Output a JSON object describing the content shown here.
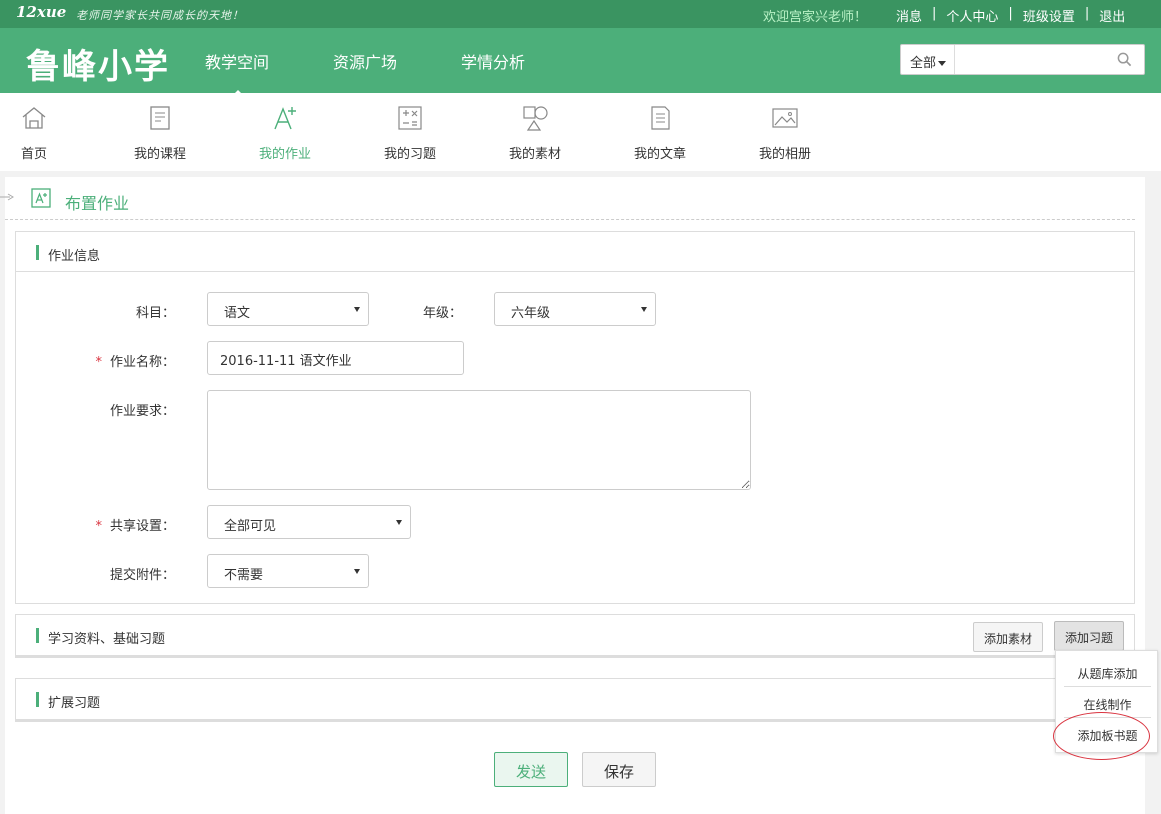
{
  "topbar": {
    "logo": "12xue",
    "slogan": "老师同学家长共同成长的天地！",
    "welcome": "欢迎宫家兴老师！",
    "links": [
      "消息",
      "个人中心",
      "班级设置",
      "退出"
    ],
    "separator": "|"
  },
  "header": {
    "school": "鲁峰小学",
    "nav": [
      "教学空间",
      "资源广场",
      "学情分析"
    ],
    "search": {
      "scope": "全部",
      "placeholder": ""
    }
  },
  "subnav": {
    "items": [
      "首页",
      "我的课程",
      "我的作业",
      "我的习题",
      "我的素材",
      "我的文章",
      "我的相册"
    ],
    "active": "我的作业"
  },
  "page": {
    "title": "布置作业"
  },
  "info": {
    "title": "作业信息",
    "subject_label": "科目：",
    "subject_value": "语文",
    "grade_label": "年级：",
    "grade_value": "六年级",
    "name_label": "作业名称：",
    "name_value": "2016-11-11 语文作业",
    "req_label": "作业要求：",
    "share_label": "共享设置：",
    "share_value": "全部可见",
    "attach_label": "提交附件：",
    "attach_value": "不需要",
    "required_mark": "*"
  },
  "materials": {
    "title": "学习资料、基础习题",
    "add_material": "添加素材",
    "add_exercise": "添加习题"
  },
  "dropdown": [
    "从题库添加",
    "在线制作",
    "添加板书题"
  ],
  "extended": {
    "title": "扩展习题"
  },
  "actions": {
    "send": "发送",
    "save": "保存"
  },
  "colors": {
    "brand": "#4caf7a",
    "topbar": "#3a9461",
    "required": "#d9333f"
  }
}
